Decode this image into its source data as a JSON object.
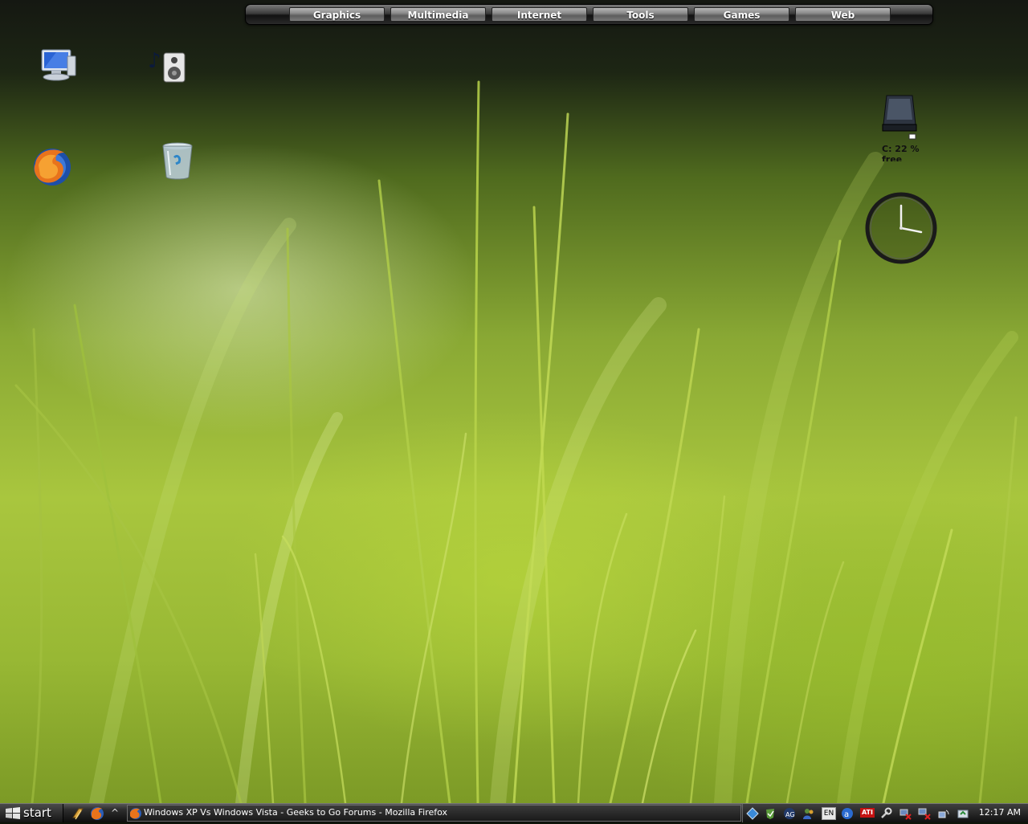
{
  "launcher": {
    "buttons": [
      "Graphics",
      "Multimedia",
      "Internet",
      "Tools",
      "Games",
      "Web"
    ]
  },
  "desktop_icons": [
    {
      "icon": "my-computer-icon"
    },
    {
      "icon": "audio-player-icon"
    },
    {
      "icon": "firefox-icon"
    },
    {
      "icon": "recycle-bin-icon"
    }
  ],
  "drive_gadget": {
    "label": "C: 22 % free"
  },
  "taskbar": {
    "start_label": "start",
    "quick_launch": [
      "show-desktop-icon",
      "firefox-icon"
    ],
    "task_title": "Windows XP Vs Windows Vista - Geeks to Go Forums - Mozilla Firefox",
    "tray": {
      "language": "EN",
      "ati": "ATI",
      "clock": "12:17 AM"
    }
  },
  "colors": {
    "grass_light": "#b6d24a",
    "grass_dark": "#5b7a1c",
    "taskbar": "#1a1a1a"
  }
}
